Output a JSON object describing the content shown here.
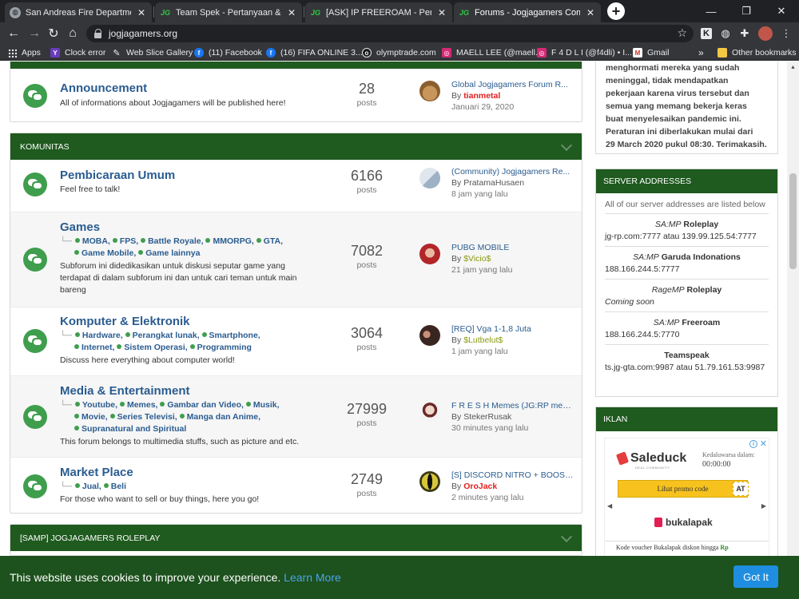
{
  "browser": {
    "tabs": [
      {
        "title": "San Andreas Fire Department - N",
        "icon": "globe-icon"
      },
      {
        "title": "Team Spek - Pertanyaan & Jawab",
        "icon": "jg-icon"
      },
      {
        "title": "[ASK] IP FREEROAM - Pertanyaan",
        "icon": "jg-icon"
      },
      {
        "title": "Forums - Jogjagamers Communi",
        "icon": "jg-icon"
      }
    ],
    "url": "jogjagamers.org",
    "bookmarks": {
      "apps": "Apps",
      "clock_error": "Clock error",
      "web_slice": "Web Slice Gallery",
      "facebook": "(11) Facebook",
      "fifa": "(16) FIFA ONLINE 3...",
      "olymptrade": "olymptrade.com",
      "maell": "MAELL LEE (@maell...",
      "f4dli": "F 4 D L I (@f4dli) • I...",
      "gmail": "Gmail",
      "more": "»",
      "other": "Other bookmarks"
    }
  },
  "forum": {
    "announcement": {
      "title": "Announcement",
      "desc": "All of informations about Jogjagamers will be published here!",
      "count": "28",
      "count_label": "posts",
      "last_title": "Global Jogjagamers Forum R...",
      "last_by": "By",
      "last_user": "tianmetal",
      "last_user_color": "#e02020",
      "last_date": "Januari 29, 2020"
    },
    "komunitas": {
      "header": "KOMUNITAS",
      "rows": [
        {
          "title": "Pembicaraan Umum",
          "desc": "Feel free to talk!",
          "count": "6166",
          "count_label": "posts",
          "last_title": "(Community) Jogjagamers Re...",
          "last_by": "By",
          "last_user": "PratamaHusaen",
          "last_user_color": "#555555",
          "last_date": "8 jam yang lalu"
        },
        {
          "title": "Games",
          "subforums_line1": [
            "MOBA,",
            "FPS,",
            "Battle Royale,",
            "MMORPG,",
            "GTA,"
          ],
          "subforums_line2": [
            "Game Mobile,",
            "Game lainnya"
          ],
          "desc": "Subforum ini didedikasikan untuk diskusi seputar game yang terdapat di dalam subforum ini dan untuk cari teman untuk main bareng",
          "count": "7082",
          "count_label": "posts",
          "last_title": "PUBG MOBILE",
          "last_by": "By",
          "last_user": "$Vicio$",
          "last_user_color": "#8a9a12",
          "last_date": "21 jam yang lalu"
        },
        {
          "title": "Komputer & Elektronik",
          "subforums_line1": [
            "Hardware,",
            "Perangkat lunak,",
            "Smartphone,"
          ],
          "subforums_line2": [
            "Internet,",
            "Sistem Operasi,",
            "Programming"
          ],
          "desc": "Discuss here everything about computer world!",
          "count": "3064",
          "count_label": "posts",
          "last_title": "[REQ] Vga 1-1,8 Juta",
          "last_by": "By",
          "last_user": "$Lutbelut$",
          "last_user_color": "#8a9a12",
          "last_date": "1 jam yang lalu"
        },
        {
          "title": "Media & Entertainment",
          "subforums_line1": [
            "Youtube,",
            "Memes,",
            "Gambar dan Video,",
            "Musik,"
          ],
          "subforums_line2": [
            "Movie,",
            "Series Televisi,",
            "Manga dan Anime,"
          ],
          "subforums_line3": [
            "Supranatural and Spiritual"
          ],
          "desc": "This forum belongs to multimedia stuffs, such as picture and etc.",
          "count": "27999",
          "count_label": "posts",
          "last_title": "F R E S H Memes (JG:RP mem...",
          "last_by": "By",
          "last_user": "StekerRusak",
          "last_user_color": "#555555",
          "last_date": "30 minutes yang lalu"
        },
        {
          "title": "Market Place",
          "subforums_line1": [
            "Jual,",
            "Beli"
          ],
          "desc": "For those who want to sell or buy things, here you go!",
          "count": "2749",
          "count_label": "posts",
          "last_title": "[S] DISCORD NITRO + BOOST ...",
          "last_by": "By",
          "last_user": "OroJack",
          "last_user_color": "#e02020",
          "last_date": "2 minutes yang lalu"
        }
      ]
    },
    "samp_header": "[SAMP] JOGJAGAMERS ROLEPLAY"
  },
  "sidebar": {
    "notice_lines": [
      "menghormati mereka yang sudah",
      "meninggal, tidak mendapatkan",
      "pekerjaan karena virus tersebut dan",
      "semua yang memang bekerja keras",
      "buat menyelesaikan pandemic ini.",
      "Peraturan ini diberlakukan mulai dari",
      "29 March 2020 pukul 08:30. Terimakasih."
    ],
    "servers": {
      "header": "SERVER ADDRESSES",
      "intro": "All of our server addresses are listed below",
      "items": [
        {
          "platform": "SA:MP",
          "name": "Roleplay",
          "addr": "jg-rp.com:7777 atau 139.99.125.54:7777"
        },
        {
          "platform": "SA:MP",
          "name": "Garuda Indonations",
          "addr": "188.166.244.5:7777"
        },
        {
          "platform": "RageMP",
          "name": "Roleplay",
          "addr": "Coming soon"
        },
        {
          "platform": "SA:MP",
          "name": "Freeroam",
          "addr": "188.166.244.5:7770"
        },
        {
          "platform": "",
          "name": "Teamspeak",
          "addr": "ts.jg-gta.com:9987 atau 51.79.161.53:9987"
        }
      ]
    },
    "iklan": {
      "header": "IKLAN",
      "brand": "Saleduck",
      "brand_sub": "DEAL COMMUNITY",
      "timer_label": "Kedaluwarsa dalam:",
      "timer": "00:00:00",
      "promo": "Lihat promo code",
      "promo_end": "AT",
      "store": "bukalapak",
      "voucher_prefix": "Kode voucher Bukalapak diskon hingga",
      "voucher_hl": "Rp"
    }
  },
  "cookie": {
    "message": "This website uses cookies to improve your experience.",
    "learn_more": "Learn More",
    "button": "Got It"
  }
}
